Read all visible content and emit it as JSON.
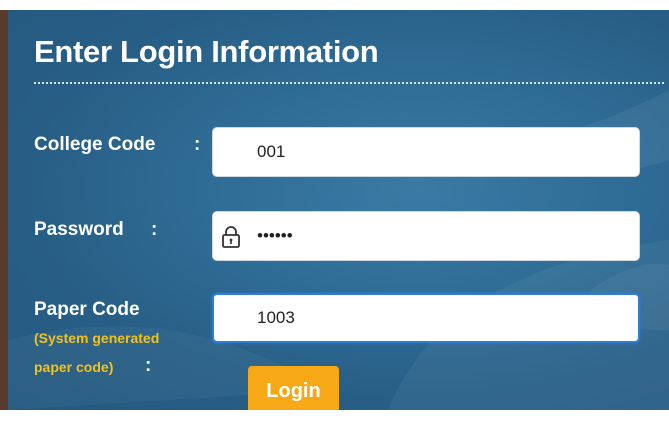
{
  "form": {
    "title": "Enter Login Information",
    "college_code": {
      "label": "College Code",
      "colon": ":",
      "value": "001"
    },
    "password": {
      "label": "Password",
      "colon": ":",
      "value": "••••••",
      "icon": "lock-icon"
    },
    "paper_code": {
      "label": "Paper Code",
      "sub_label_line1": "(System generated",
      "sub_label_line2": "paper code)",
      "colon": ":",
      "value": "1003"
    },
    "login_label": "Login"
  },
  "colors": {
    "panel_bg": "#2f6d96",
    "sub_label": "#f2c21b",
    "login_button": "#f6a817",
    "focus_border": "#2f7fd1"
  }
}
